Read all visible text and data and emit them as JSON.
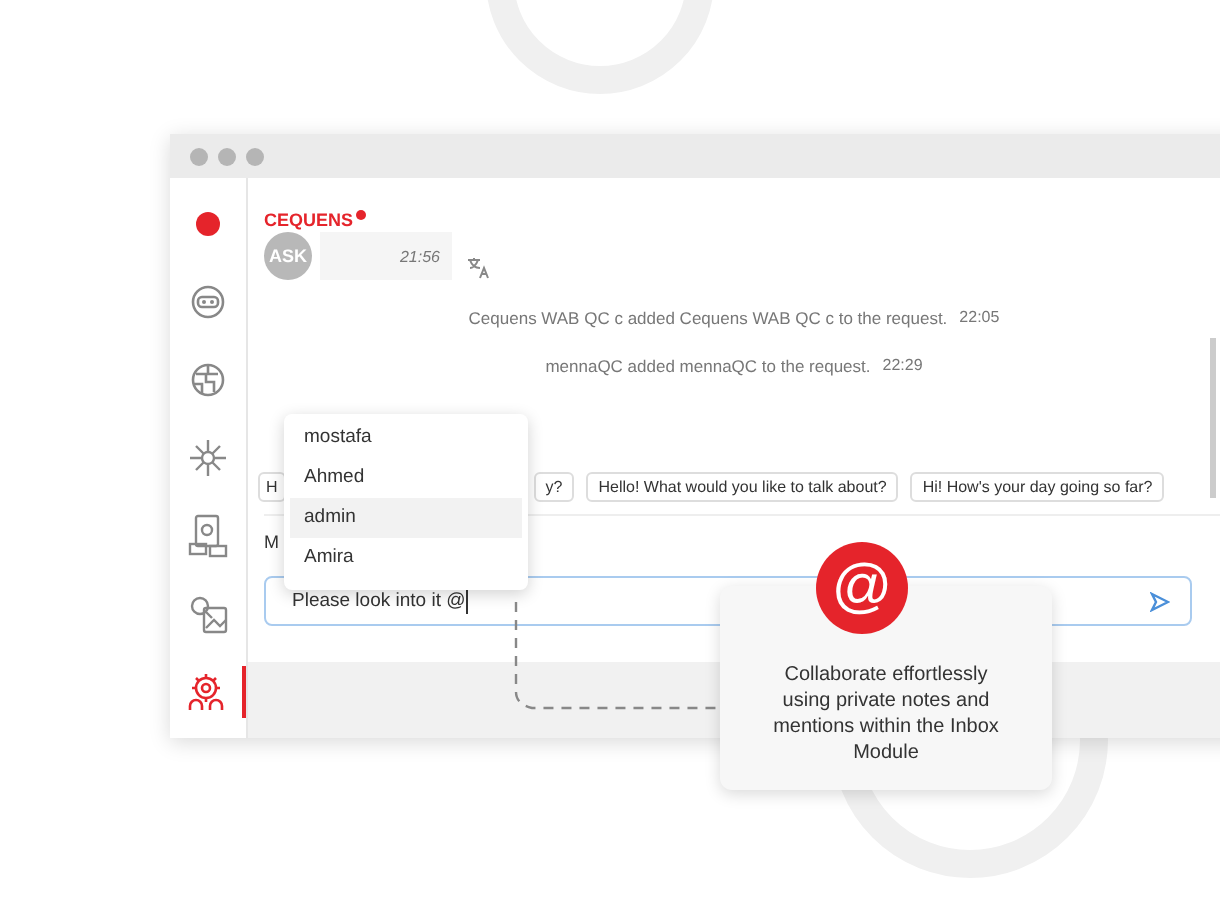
{
  "sidebar": {
    "items": [
      {
        "kind": "dot",
        "selected": false
      },
      {
        "kind": "bot",
        "selected": false
      },
      {
        "kind": "globe",
        "selected": false
      },
      {
        "kind": "network",
        "selected": false
      },
      {
        "kind": "document",
        "selected": false
      },
      {
        "kind": "media",
        "selected": false
      },
      {
        "kind": "gear",
        "selected": true
      }
    ]
  },
  "brand": "CEQUENS",
  "message": {
    "avatar": "ASK",
    "time": "21:56"
  },
  "events": [
    {
      "text": "Cequens WAB QC c added Cequens WAB QC c to the request.",
      "time": "22:05"
    },
    {
      "text": "mennaQC added mennaQC to the request.",
      "time": "22:29"
    }
  ],
  "chips": [
    "H",
    "y?",
    "Hello! What would you like to talk about?",
    "Hi! How's your day going so far?"
  ],
  "label": "M",
  "mentions": [
    {
      "name": "mostafa",
      "selected": false
    },
    {
      "name": "Ahmed",
      "selected": false
    },
    {
      "name": "admin",
      "selected": true
    },
    {
      "name": "Amira",
      "selected": false
    }
  ],
  "composer": {
    "value": "Please look into it @"
  },
  "callout": {
    "symbol": "@",
    "text": "Collaborate effortlessly using private notes and mentions within the Inbox Module"
  }
}
